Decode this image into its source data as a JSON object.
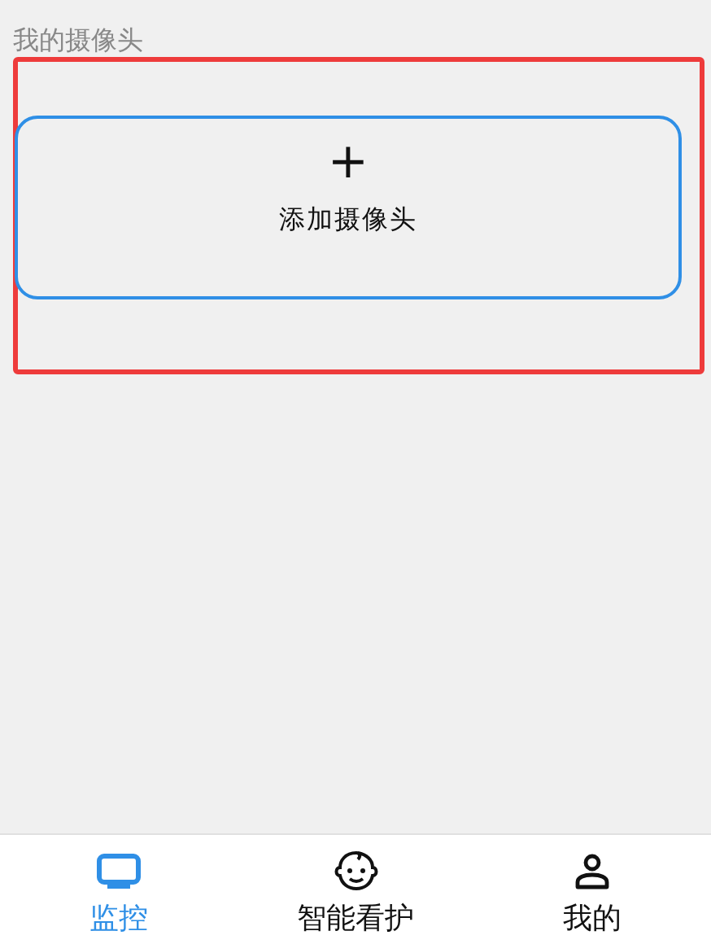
{
  "section_title": "我的摄像头",
  "add_camera": {
    "icon": "+",
    "label": "添加摄像头"
  },
  "tabs": [
    {
      "kind": "monitor",
      "label": "监控",
      "selected": true
    },
    {
      "kind": "baby",
      "label": "智能看护",
      "selected": false
    },
    {
      "kind": "person",
      "label": "我的",
      "selected": false
    }
  ]
}
